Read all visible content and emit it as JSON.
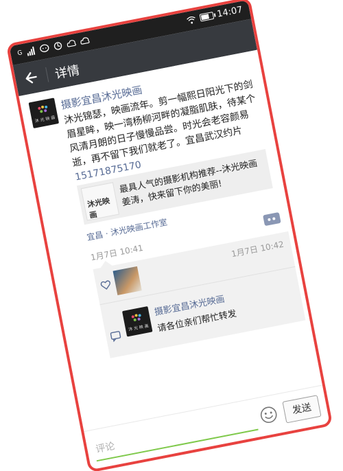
{
  "status_bar": {
    "time": "14:07",
    "signal_text": "G",
    "battery_level": 0.7
  },
  "header": {
    "title": "详情"
  },
  "post": {
    "author": "摄影宜昌沐光映画",
    "avatar_text": "沐 光 映 画",
    "body": "沐光锦瑟，映画流年。剪一幅熙日阳光下的剑眉星眸，映一湾杨柳河畔的凝脂肌肤，待某个风清月朗的日子慢慢品尝。时光会老容颜易逝，再不留下我们就老了。宜昌武汉约片",
    "phone": "15171875170",
    "share_card": {
      "thumb_text": "沐光映画",
      "title": "最具人气的摄影机构推荐--沐光映画姜涛，快来留下你的美丽!"
    },
    "location": "宜昌 · 沐光映画工作室",
    "time": "1月7日 10:41"
  },
  "likes": {
    "time": "1月7日 10:42"
  },
  "comments": [
    {
      "author": "摄影宜昌沐光映画",
      "avatar_text": "沐 光 映 画",
      "text": "请各位亲们帮忙转发"
    }
  ],
  "input_bar": {
    "placeholder": "评论",
    "send_label": "发送"
  },
  "colors": {
    "frame": "#e8423f",
    "link": "#576b95",
    "titlebar": "#373a3f",
    "input_underline": "#7fc94b"
  }
}
